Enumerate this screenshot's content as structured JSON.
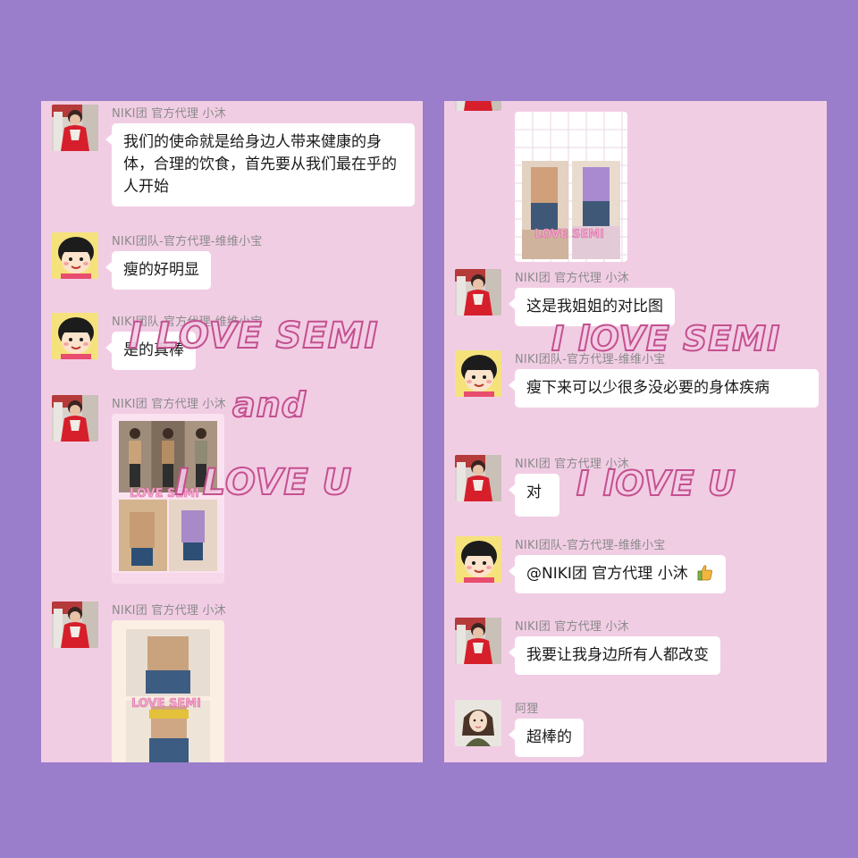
{
  "colors": {
    "page_background": "#9a7dcb",
    "chat_background": "#f1cde4",
    "bubble": "#ffffff",
    "sender_text": "#8a8a8a",
    "overlay_outline": "#c4508f"
  },
  "left_chat": {
    "messages": [
      {
        "sender": "NIKI团  官方代理 小沐",
        "avatar": "red-dress-avatar",
        "text": "我们的使命就是给身边人带来健康的身体，合理的饮食，首先要从我们最在乎的人开始"
      },
      {
        "sender": "NIKI团队-官方代理-维维小宝",
        "avatar": "cartoon-girl-avatar",
        "text": "瘦的好明显"
      },
      {
        "sender": "NIKI团队-官方代理-维维小宝",
        "avatar": "cartoon-girl-avatar",
        "text": "是的真棒"
      },
      {
        "sender": "NIKI团  官方代理 小沐",
        "avatar": "red-dress-avatar",
        "image": "before-after-collage-photo",
        "image_caption": "LOVE  SEMI"
      },
      {
        "sender": "NIKI团  官方代理 小沐",
        "avatar": "red-dress-avatar",
        "image": "waist-comparison-photo",
        "image_caption": "LOVE  SEMI"
      }
    ]
  },
  "right_chat": {
    "messages": [
      {
        "sender": "",
        "avatar": "red-dress-avatar",
        "image": "waist-comparison-photo",
        "image_caption": "LOVE  SEMI"
      },
      {
        "sender": "NIKI团  官方代理 小沐",
        "avatar": "red-dress-avatar",
        "text": "这是我姐姐的对比图"
      },
      {
        "sender": "NIKI团队-官方代理-维维小宝",
        "avatar": "cartoon-girl-avatar",
        "text": "瘦下来可以少很多没必要的身体疾病"
      },
      {
        "sender": "NIKI团  官方代理 小沐",
        "avatar": "red-dress-avatar",
        "text": "对"
      },
      {
        "sender": "NIKI团队-官方代理-维维小宝",
        "avatar": "cartoon-girl-avatar",
        "text": "@NIKI团  官方代理 小沐",
        "emoji": "thumbs-up-icon"
      },
      {
        "sender": "NIKI团  官方代理 小沐",
        "avatar": "red-dress-avatar",
        "text": "我要让我身边所有人都改变"
      },
      {
        "sender": "阿狸",
        "avatar": "woman-portrait-avatar",
        "text": "超棒的"
      }
    ]
  },
  "overlay": {
    "left_line1": "I LOVE  SEMI",
    "left_line2": "and",
    "left_line3": "I LOVE  U",
    "right_line1": "I  lOVE  SEMI",
    "right_line3": "I  lOVE  U"
  }
}
